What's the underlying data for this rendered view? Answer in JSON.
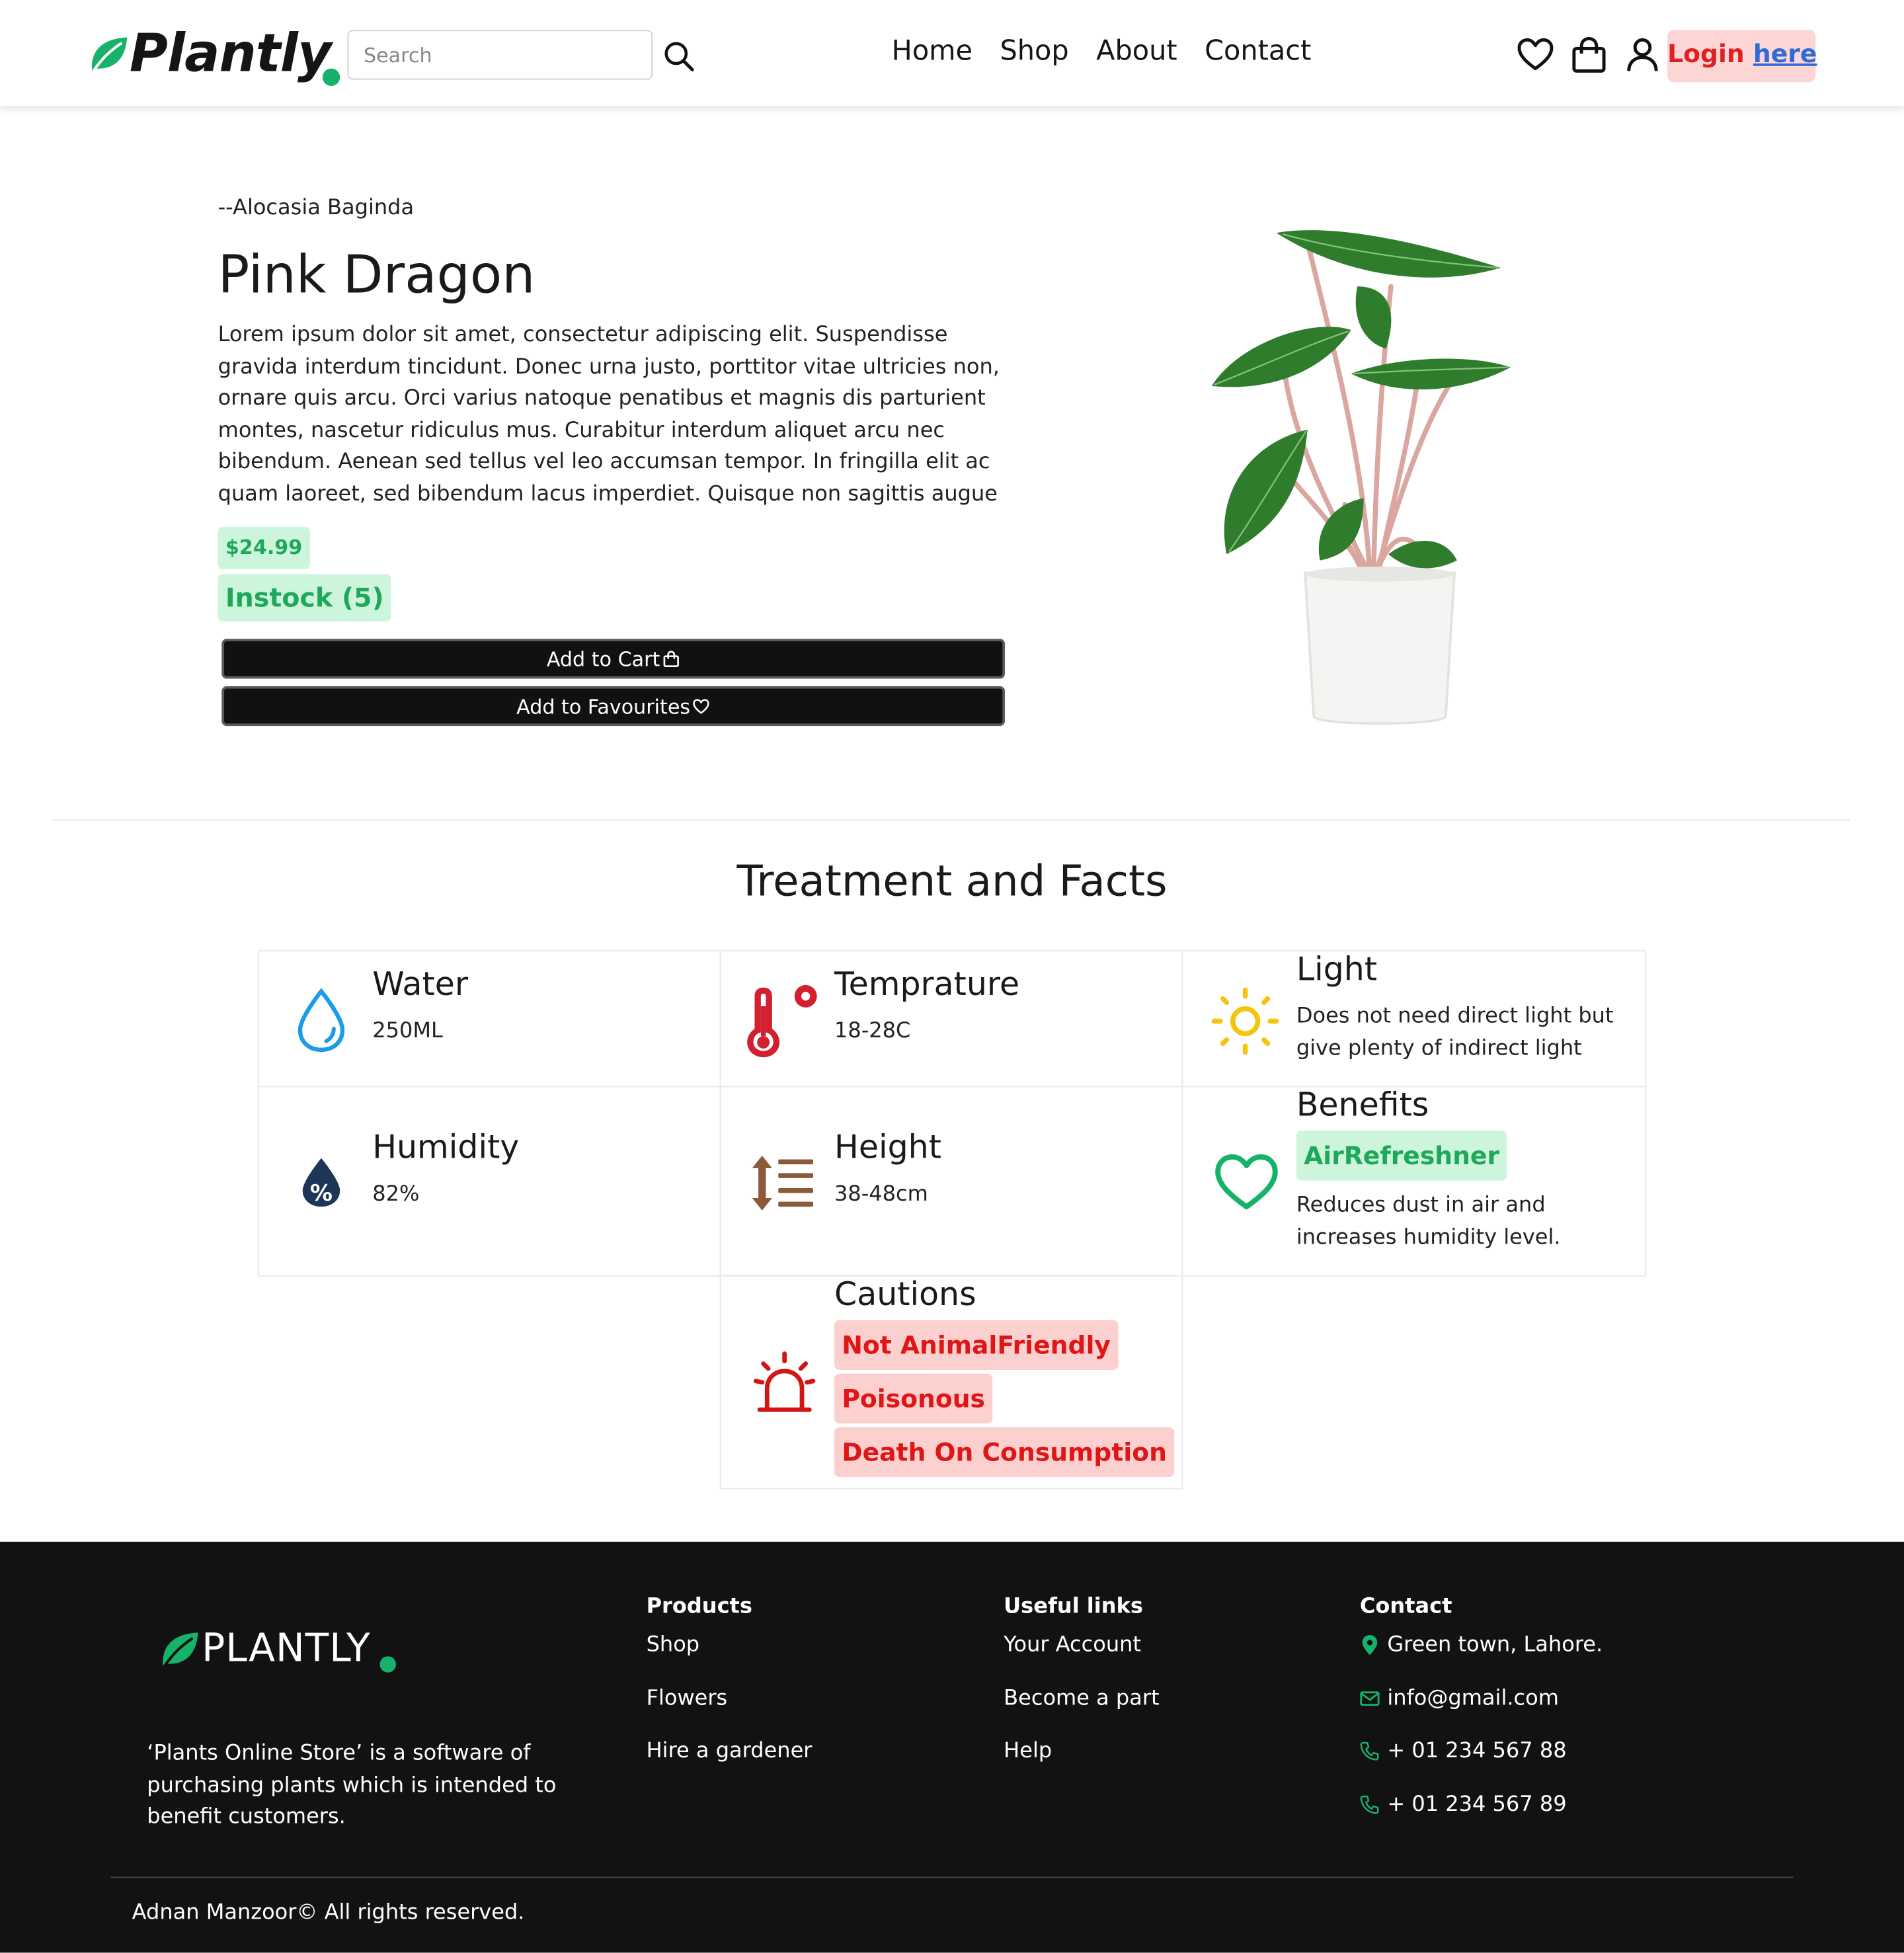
{
  "brand": {
    "name": "Plantly",
    "footer_name": "PLANTLY",
    "accent_color": "#17b26a"
  },
  "header": {
    "search_placeholder": "Search",
    "nav": [
      "Home",
      "Shop",
      "About",
      "Contact"
    ],
    "icons": [
      "heart-icon",
      "bag-icon",
      "user-icon"
    ],
    "login_text": "Login",
    "login_link": "here"
  },
  "product": {
    "species": "--Alocasia Baginda",
    "name": "Pink Dragon",
    "description": "Lorem ipsum dolor sit amet, consectetur adipiscing elit. Suspendisse gravida interdum tincidunt. Donec urna justo, porttitor vitae ultricies non, ornare quis arcu. Orci varius natoque penatibus et magnis dis parturient montes, nascetur ridiculus mus. Curabitur interdum aliquet arcu nec bibendum. Aenean sed tellus vel leo accumsan tempor. In fringilla elit ac quam laoreet, sed bibendum lacus imperdiet. Quisque non sagittis augue",
    "price": "$24.99",
    "stock": "Instock (5)",
    "add_to_cart": "Add to Cart",
    "add_to_favourites": "Add to Favourites"
  },
  "facts": {
    "section_title": "Treatment and Facts",
    "water": {
      "title": "Water",
      "value": "250ML"
    },
    "temperature": {
      "title": "Temprature",
      "value": "18-28C"
    },
    "light": {
      "title": "Light",
      "value": "Does not need direct light but give plenty of indirect light"
    },
    "humidity": {
      "title": "Humidity",
      "value": "82%"
    },
    "height": {
      "title": "Height",
      "value": "38-48cm"
    },
    "benefits": {
      "title": "Benefits",
      "tag": "AirRefreshner",
      "value": "Reduces dust in air and increases humidity level."
    },
    "cautions": {
      "title": "Cautions",
      "tags": [
        "Not AnimalFriendly",
        "Poisonous",
        "Death On Consumption"
      ]
    }
  },
  "footer": {
    "about": "‘Plants Online Store’ is a software of purchasing plants which is intended to benefit customers.",
    "products": {
      "title": "Products",
      "links": [
        "Shop",
        "Flowers",
        "Hire a gardener"
      ]
    },
    "useful": {
      "title": "Useful links",
      "links": [
        "Your Account",
        "Become a part",
        "Help"
      ]
    },
    "contact": {
      "title": "Contact",
      "address": "Green town, Lahore.",
      "email": "info@gmail.com",
      "phones": [
        "+ 01 234 567 88",
        "+ 01 234 567 89"
      ]
    },
    "copyright": "Adnan Manzoor© All rights reserved."
  }
}
